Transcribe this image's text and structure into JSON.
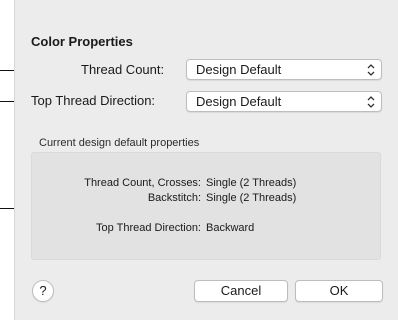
{
  "dialog": {
    "section_title": "Color Properties",
    "thread_count": {
      "label": "Thread Count:",
      "value": "Design Default"
    },
    "top_thread_direction": {
      "label": "Top Thread Direction:",
      "value": "Design Default"
    },
    "group_caption": "Current design default properties",
    "properties": [
      {
        "label": "Thread Count, Crosses:",
        "value": "Single (2 Threads)"
      },
      {
        "label": "Backstitch:",
        "value": "Single (2 Threads)"
      },
      {
        "label": "Top Thread Direction:",
        "value": "Backward"
      }
    ],
    "buttons": {
      "help": "?",
      "cancel": "Cancel",
      "ok": "OK"
    }
  }
}
